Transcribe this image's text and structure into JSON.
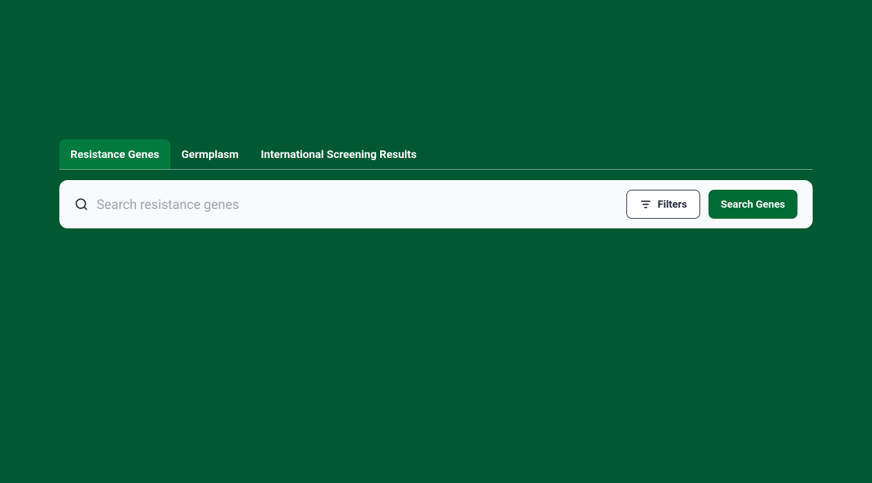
{
  "tabs": [
    {
      "label": "Resistance Genes",
      "active": true
    },
    {
      "label": "Germplasm",
      "active": false
    },
    {
      "label": "International Screening Results",
      "active": false
    }
  ],
  "search": {
    "placeholder": "Search resistance genes",
    "value": ""
  },
  "buttons": {
    "filters_label": "Filters",
    "search_label": "Search Genes"
  }
}
